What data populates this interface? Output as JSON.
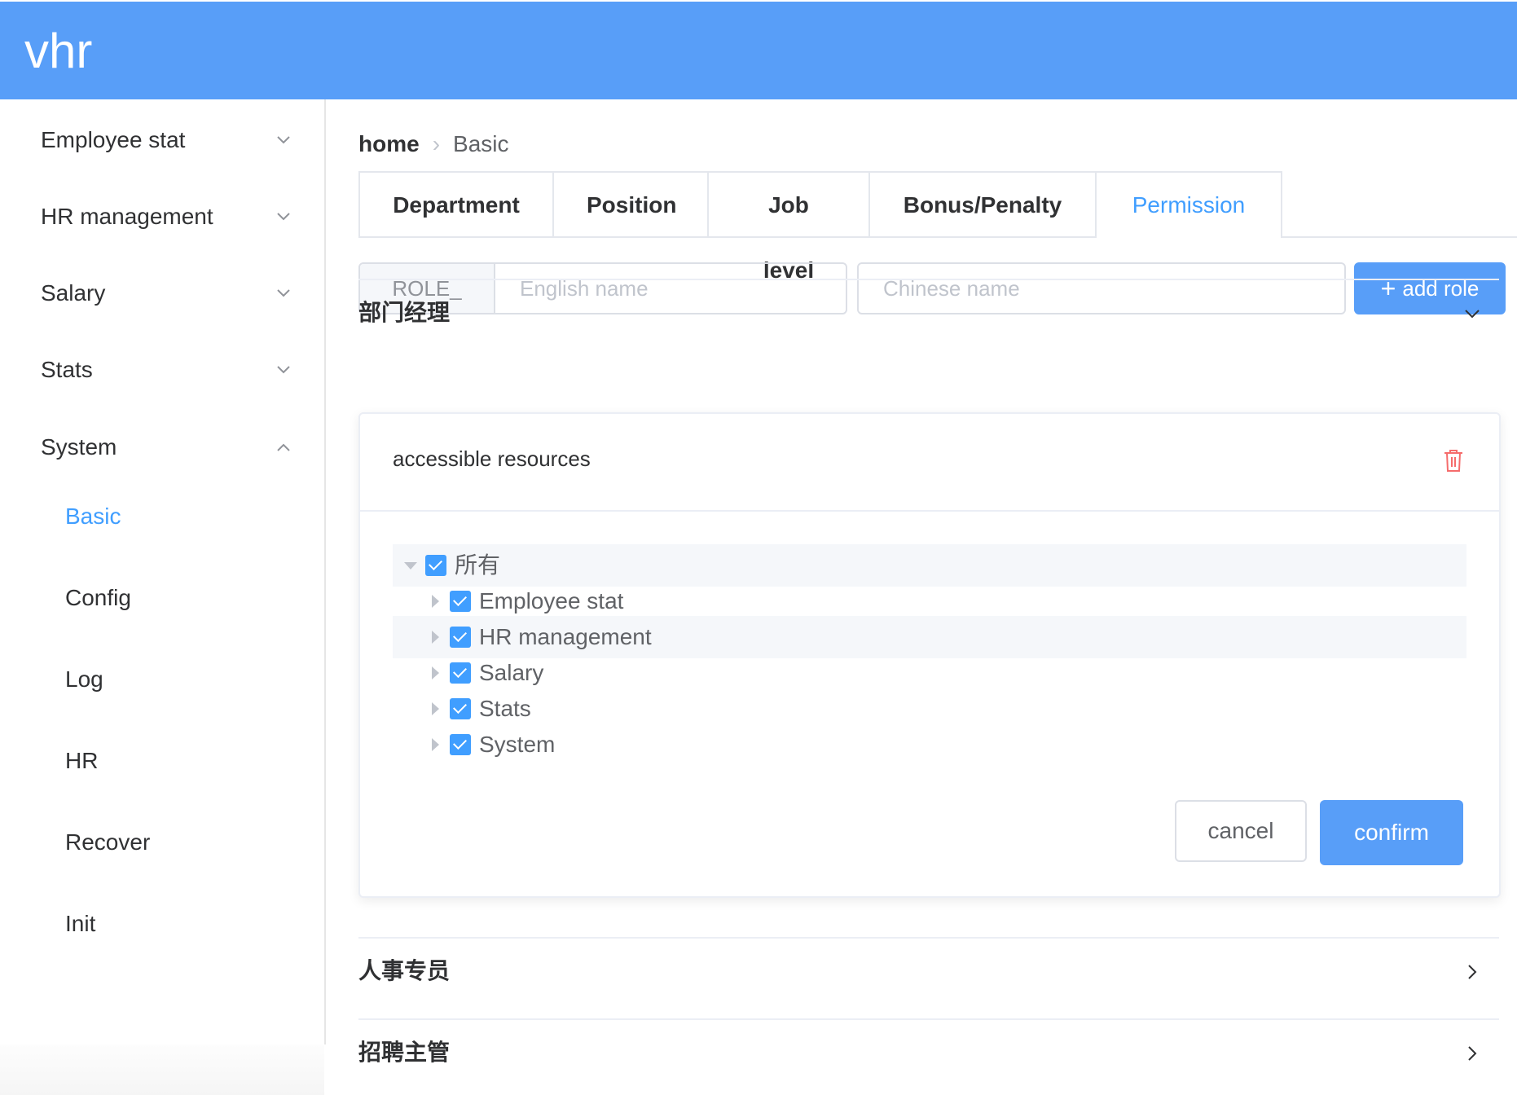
{
  "app": {
    "title": "vhr"
  },
  "sidebar": {
    "menus": [
      {
        "label": "Employee stat",
        "expanded": false
      },
      {
        "label": "HR management",
        "expanded": false
      },
      {
        "label": "Salary",
        "expanded": false
      },
      {
        "label": "Stats",
        "expanded": false
      },
      {
        "label": "System",
        "expanded": true
      }
    ],
    "system_items": [
      {
        "label": "Basic",
        "active": true
      },
      {
        "label": "Config"
      },
      {
        "label": "Log"
      },
      {
        "label": "HR"
      },
      {
        "label": "Recover"
      },
      {
        "label": "Init"
      }
    ]
  },
  "breadcrumb": {
    "home": "home",
    "current": "Basic"
  },
  "tabs": [
    {
      "label": "Department"
    },
    {
      "label": "Position"
    },
    {
      "label": "Job level"
    },
    {
      "label": "Bonus/Penalty"
    },
    {
      "label": "Permission",
      "active": true
    }
  ],
  "form": {
    "prefix": "ROLE_",
    "english_placeholder": "English name",
    "chinese_placeholder": "Chinese name",
    "add_label": "add role"
  },
  "roles": [
    {
      "name": "部门经理",
      "expanded": true
    },
    {
      "name": "人事专员",
      "expanded": false
    },
    {
      "name": "招聘主管",
      "expanded": false
    }
  ],
  "panel": {
    "header": "accessible resources",
    "tree": {
      "root": {
        "label": "所有",
        "checked": true
      },
      "children": [
        {
          "label": "Employee stat",
          "checked": true
        },
        {
          "label": "HR management",
          "checked": true
        },
        {
          "label": "Salary",
          "checked": true
        },
        {
          "label": "Stats",
          "checked": true
        },
        {
          "label": "System",
          "checked": true
        }
      ]
    },
    "cancel_label": "cancel",
    "confirm_label": "confirm"
  },
  "colors": {
    "header_bg": "#589ef8",
    "accent": "#409eff",
    "danger": "#f56c6c"
  }
}
